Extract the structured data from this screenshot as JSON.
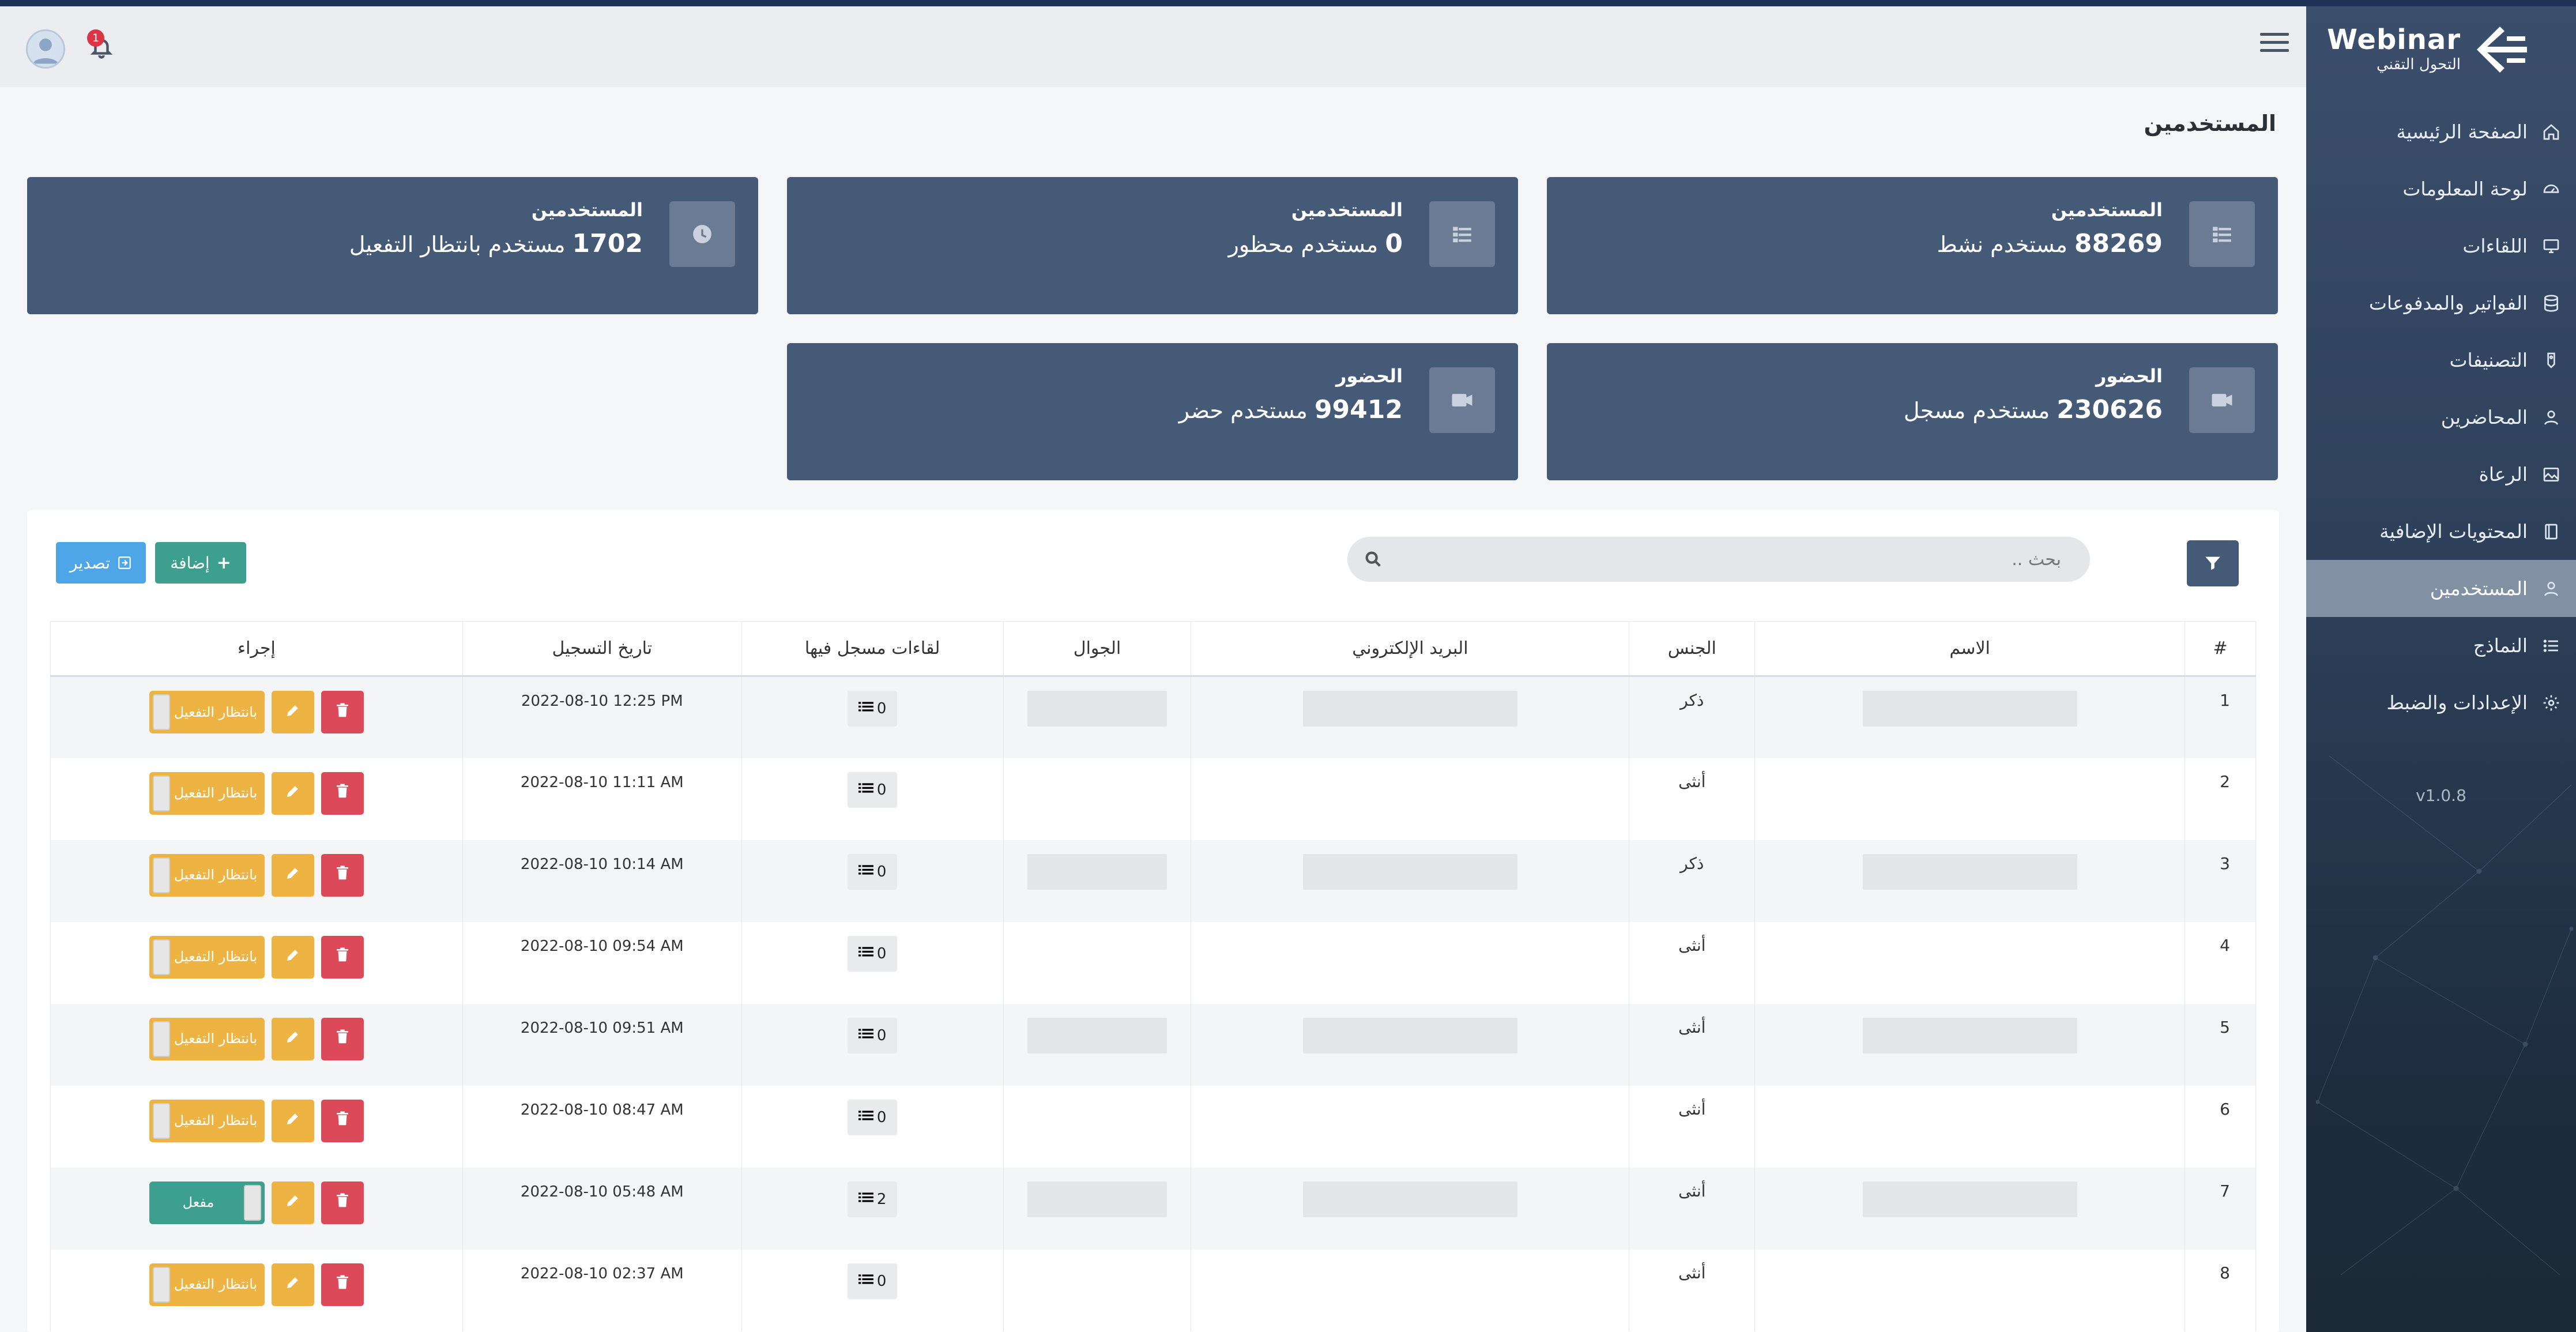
{
  "app": {
    "logo_title": "Webinar",
    "logo_subtitle": "التحول التقني",
    "version": "v1.0.8",
    "notifications_count": "1"
  },
  "colors": {
    "sidebar": "#3b4e6b",
    "card": "#455a76",
    "pending": "#eeb443",
    "active": "#3d9f8d",
    "delete": "#dc4a5a",
    "export": "#4ea5e8",
    "add": "#3d9f8d"
  },
  "sidebar": {
    "items": [
      {
        "label": "الصفحة الرئيسية",
        "icon": "home-icon"
      },
      {
        "label": "لوحة المعلومات",
        "icon": "dashboard-icon"
      },
      {
        "label": "اللقاءات",
        "icon": "monitor-icon"
      },
      {
        "label": "الفواتير والمدفوعات",
        "icon": "database-icon"
      },
      {
        "label": "التصنيفات",
        "icon": "tag-icon"
      },
      {
        "label": "المحاضرين",
        "icon": "user-icon"
      },
      {
        "label": "الرعاة",
        "icon": "image-icon"
      },
      {
        "label": "المحتويات الإضافية",
        "icon": "book-icon"
      },
      {
        "label": "المستخدمين",
        "icon": "user-icon",
        "active": true
      },
      {
        "label": "النماذج",
        "icon": "list-icon"
      },
      {
        "label": "الإعدادات والضبط",
        "icon": "gear-icon"
      }
    ]
  },
  "page": {
    "title": "المستخدمين"
  },
  "cards": [
    {
      "title": "المستخدمين",
      "number": "88269",
      "text": "مستخدم نشط",
      "icon": "list-icon"
    },
    {
      "title": "المستخدمين",
      "number": "0",
      "text": "مستخدم محظور",
      "icon": "list-icon"
    },
    {
      "title": "المستخدمين",
      "number": "1702",
      "text": "مستخدم بانتظار التفعيل",
      "icon": "clock-icon"
    },
    {
      "title": "الحضور",
      "number": "230626",
      "text": "مستخدم مسجل",
      "icon": "video-icon"
    },
    {
      "title": "الحضور",
      "number": "99412",
      "text": "مستخدم حضر",
      "icon": "video-icon"
    }
  ],
  "toolbar": {
    "search_placeholder": "بحث ..",
    "add_label": "إضافة",
    "export_label": "تصدير"
  },
  "table": {
    "columns": [
      "#",
      "الاسم",
      "الجنس",
      "البريد الإلكتروني",
      "الجوال",
      "لقاءات مسجل فيها",
      "تاريخ التسجيل",
      "إجراء"
    ],
    "rows": [
      {
        "num": "1",
        "gender": "ذكر",
        "name_masked": true,
        "email_masked": true,
        "phone_masked": true,
        "meetings": "0",
        "date": "2022-08-10 12:25 PM",
        "status": "بانتظار التفعيل",
        "status_state": "pending"
      },
      {
        "num": "2",
        "gender": "أنثى",
        "name_masked": false,
        "email_masked": false,
        "phone_masked": false,
        "meetings": "0",
        "date": "2022-08-10 11:11 AM",
        "status": "بانتظار التفعيل",
        "status_state": "pending"
      },
      {
        "num": "3",
        "gender": "ذكر",
        "name_masked": true,
        "email_masked": true,
        "phone_masked": true,
        "meetings": "0",
        "date": "2022-08-10 10:14 AM",
        "status": "بانتظار التفعيل",
        "status_state": "pending"
      },
      {
        "num": "4",
        "gender": "أنثى",
        "name_masked": false,
        "email_masked": false,
        "phone_masked": false,
        "meetings": "0",
        "date": "2022-08-10 09:54 AM",
        "status": "بانتظار التفعيل",
        "status_state": "pending"
      },
      {
        "num": "5",
        "gender": "أنثى",
        "name_masked": true,
        "email_masked": true,
        "phone_masked": true,
        "meetings": "0",
        "date": "2022-08-10 09:51 AM",
        "status": "بانتظار التفعيل",
        "status_state": "pending"
      },
      {
        "num": "6",
        "gender": "أنثى",
        "name_masked": false,
        "email_masked": false,
        "phone_masked": false,
        "meetings": "0",
        "date": "2022-08-10 08:47 AM",
        "status": "بانتظار التفعيل",
        "status_state": "pending"
      },
      {
        "num": "7",
        "gender": "أنثى",
        "name_masked": true,
        "email_masked": true,
        "phone_masked": true,
        "meetings": "2",
        "date": "2022-08-10 05:48 AM",
        "status": "مفعل",
        "status_state": "active"
      },
      {
        "num": "8",
        "gender": "أنثى",
        "name_masked": false,
        "email_masked": false,
        "phone_masked": false,
        "meetings": "0",
        "date": "2022-08-10 02:37 AM",
        "status": "بانتظار التفعيل",
        "status_state": "pending"
      }
    ]
  }
}
